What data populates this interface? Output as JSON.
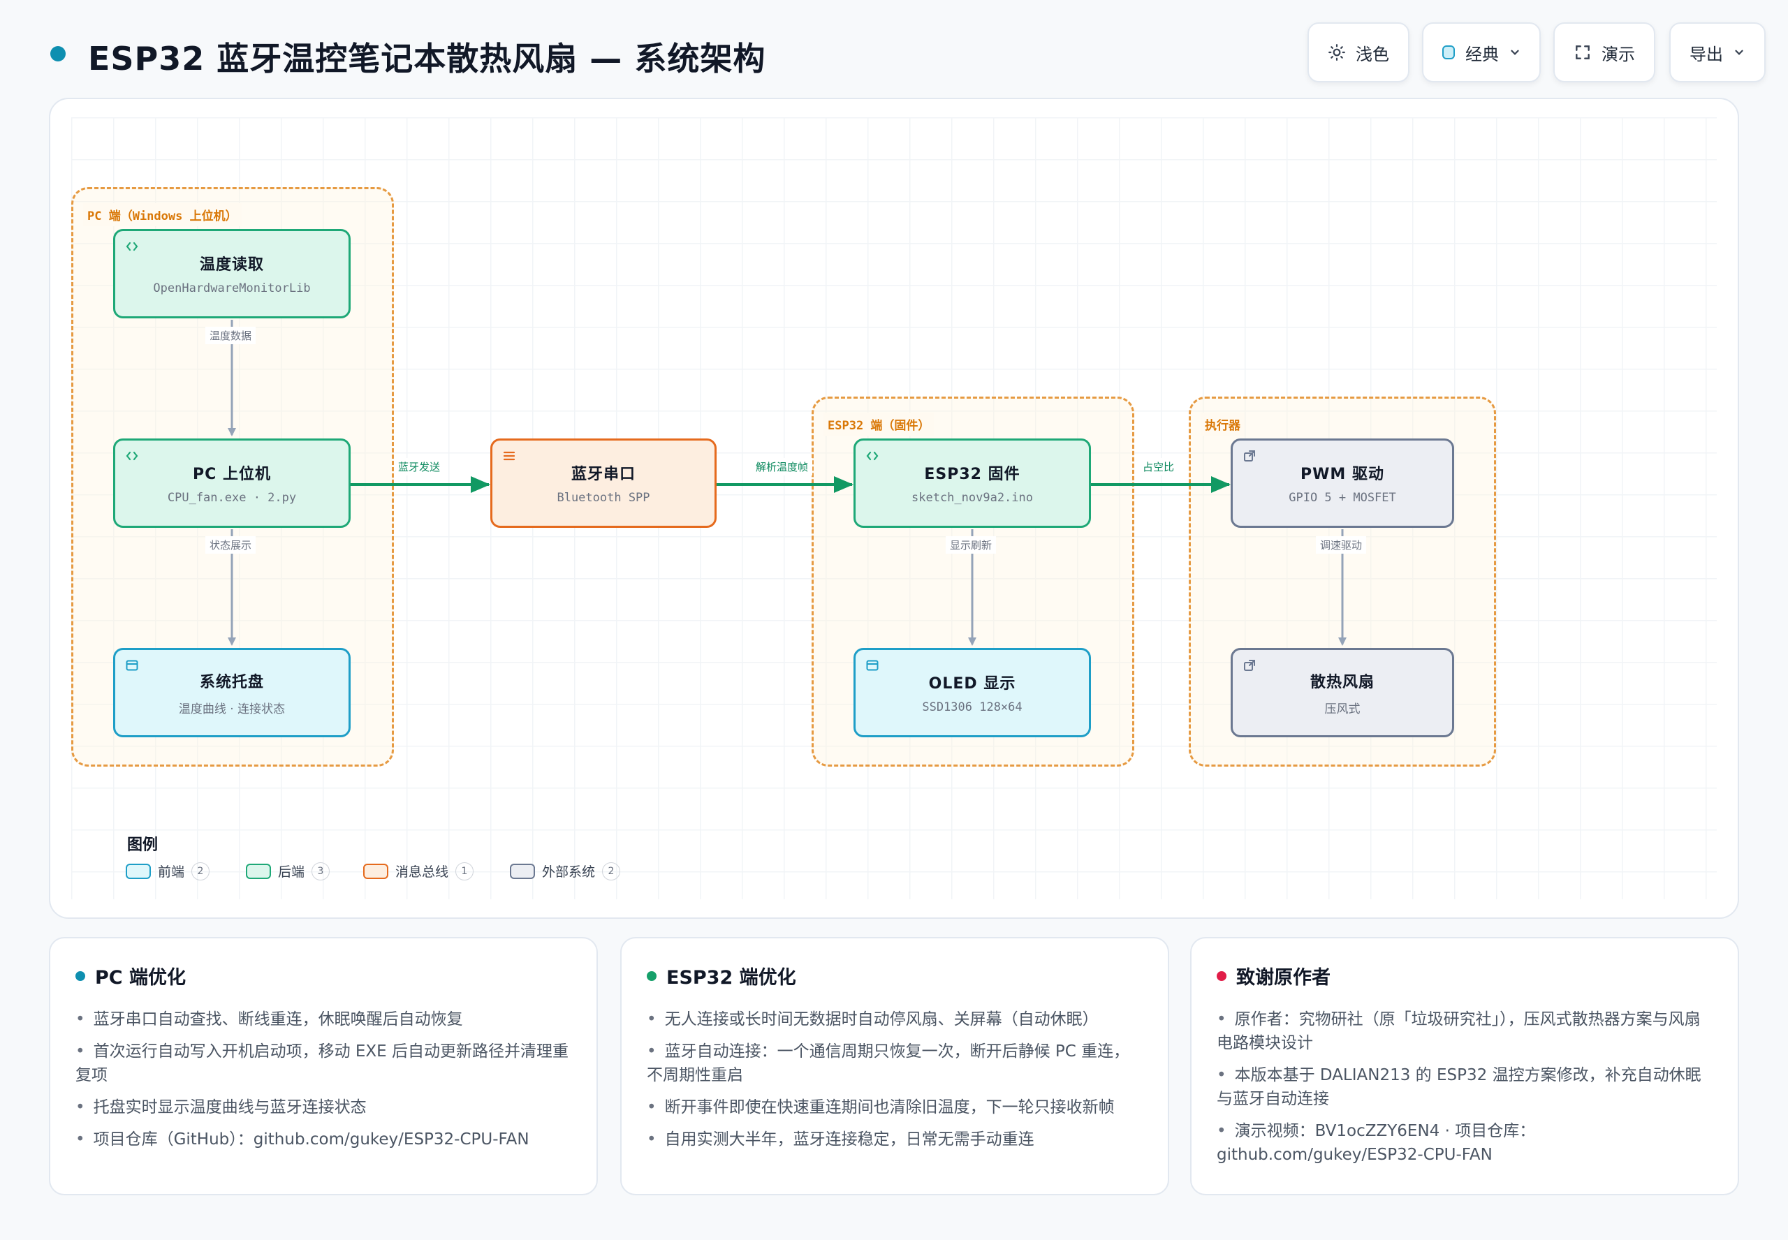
{
  "header": {
    "title": "ESP32 蓝牙温控笔记本散热风扇 — 系统架构",
    "buttons": {
      "theme": "浅色",
      "style": "经典",
      "present": "演示",
      "export": "导出"
    }
  },
  "diagram": {
    "groups": {
      "pc": "PC 端（Windows 上位机）",
      "esp32": "ESP32 端（固件）",
      "actuator": "执行器"
    },
    "nodes": {
      "temp_read": {
        "title": "温度读取",
        "sub": "OpenHardwareMonitorLib"
      },
      "pc_host": {
        "title": "PC 上位机",
        "sub": "CPU_fan.exe · 2.py"
      },
      "tray": {
        "title": "系统托盘",
        "sub": "温度曲线 · 连接状态"
      },
      "bt_serial": {
        "title": "蓝牙串口",
        "sub": "Bluetooth SPP"
      },
      "esp32_fw": {
        "title": "ESP32 固件",
        "sub": "sketch_nov9a2.ino"
      },
      "oled": {
        "title": "OLED 显示",
        "sub": "SSD1306 128×64"
      },
      "pwm": {
        "title": "PWM 驱动",
        "sub": "GPIO 5 + MOSFET"
      },
      "fan": {
        "title": "散热风扇",
        "sub": "压风式"
      }
    },
    "edges": {
      "temp_data": "温度数据",
      "status_show": "状态展示",
      "bt_send": "蓝牙发送",
      "parse_frame": "解析温度帧",
      "display_refresh": "显示刷新",
      "duty": "占空比",
      "speed_drive": "调速驱动"
    },
    "legend": {
      "title": "图例",
      "items": [
        {
          "label": "前端",
          "count": "2"
        },
        {
          "label": "后端",
          "count": "3"
        },
        {
          "label": "消息总线",
          "count": "1"
        },
        {
          "label": "外部系统",
          "count": "2"
        }
      ]
    }
  },
  "cards": [
    {
      "title": "PC 端优化",
      "color": "#0e8fb0",
      "items": [
        "蓝牙串口自动查找、断线重连，休眠唤醒后自动恢复",
        "首次运行自动写入开机启动项，移动 EXE 后自动更新路径并清理重复项",
        "托盘实时显示温度曲线与蓝牙连接状态",
        "项目仓库（GitHub）：github.com/gukey/ESP32-CPU-FAN"
      ]
    },
    {
      "title": "ESP32 端优化",
      "color": "#16a06a",
      "items": [
        "无人连接或长时间无数据时自动停风扇、关屏幕（自动休眠）",
        "蓝牙自动连接：一个通信周期只恢复一次，断开后静候 PC 重连，不周期性重启",
        "断开事件即使在快速重连期间也清除旧温度，下一轮只接收新帧",
        "自用实测大半年，蓝牙连接稳定，日常无需手动重连"
      ]
    },
    {
      "title": "致谢原作者",
      "color": "#e11d48",
      "items": [
        "原作者：究物研社（原「垃圾研究社」），压风式散热器方案与风扇电路模块设计",
        "本版本基于 DALIAN213 的 ESP32 温控方案修改，补充自动休眠与蓝牙自动连接",
        "演示视频：BV1ocZZY6EN4 · 项目仓库：github.com/gukey/ESP32-CPU-FAN"
      ]
    }
  ]
}
